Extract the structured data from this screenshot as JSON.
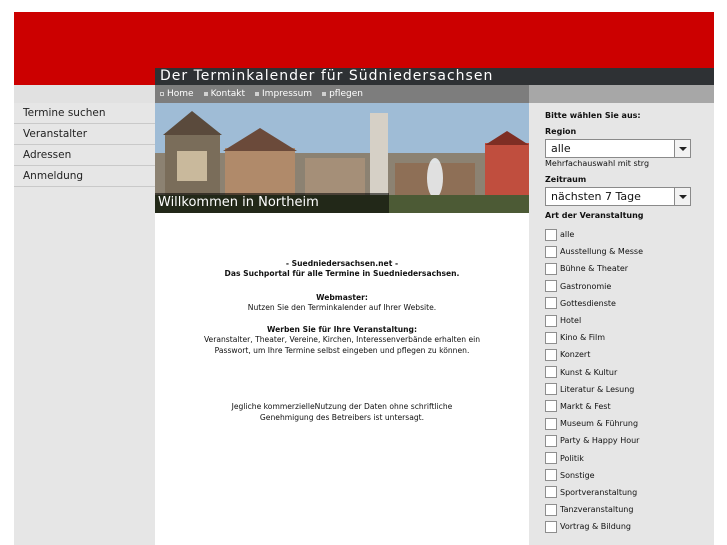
{
  "header": {
    "title": "Der Terminkalender für Südniedersachsen"
  },
  "topnav": [
    "Home",
    "Kontakt",
    "Impressum",
    "pflegen"
  ],
  "sidebar": [
    "Termine suchen",
    "Veranstalter",
    "Adressen",
    "Anmeldung"
  ],
  "banner": {
    "caption": "Willkommen in Northeim"
  },
  "main": {
    "site_name": "- Suedniedersachsen.net -",
    "tagline": "Das Suchportal für alle Termine in Suedniedersachsen.",
    "webmaster_heading": "Webmaster:",
    "webmaster_text": "Nutzen Sie den Terminkalender auf Ihrer Website.",
    "promo_heading": "Werben Sie für Ihre Veranstaltung:",
    "promo_line1": "Veranstalter, Theater, Vereine, Kirchen, Interessenverbände erhalten ein",
    "promo_line2": "Passwort, um Ihre Termine selbst eingeben und pflegen zu können.",
    "legal_line1": "Jegliche kommerzielleNutzung der Daten ohne schriftliche",
    "legal_line2": "Genehmigung des Betreibers ist untersagt."
  },
  "filters": {
    "heading": "Bitte wählen Sie aus:",
    "region_label": "Region",
    "region_value": "alle",
    "multi_hint": "Mehrfachauswahl mit strg",
    "zeitraum_label": "Zeitraum",
    "zeitraum_value": "nächsten 7 Tage",
    "art_label": "Art der Veranstaltung",
    "categories": [
      "alle",
      "Ausstellung & Messe",
      "Bühne & Theater",
      "Gastronomie",
      "Gottesdienste",
      "Hotel",
      "Kino & Film",
      "Konzert",
      "Kunst & Kultur",
      "Literatur & Lesung",
      "Markt & Fest",
      "Museum & Führung",
      "Party & Happy Hour",
      "Politik",
      "Sonstige",
      "Sportveranstaltung",
      "Tanzveranstaltung",
      "Vortrag & Bildung"
    ]
  },
  "colors": {
    "brand_red": "#cc0000",
    "title_bar": "#2e3134",
    "sidebar_bg": "#e6e6e6"
  }
}
